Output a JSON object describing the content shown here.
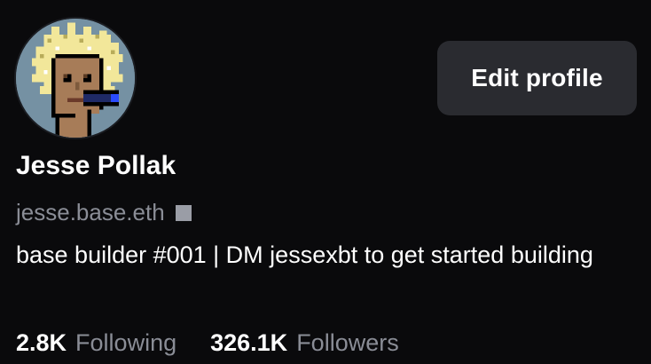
{
  "profile": {
    "display_name": "Jesse Pollak",
    "handle": "jesse.base.eth",
    "bio": "base builder #001 | DM jessexbt to get started building",
    "avatar_icon": "pixel-punk-avatar",
    "handle_badge_icon": "square-badge-icon"
  },
  "actions": {
    "edit_profile_label": "Edit profile"
  },
  "stats": {
    "following_count": "2.8K",
    "following_label": "Following",
    "followers_count": "326.1K",
    "followers_label": "Followers"
  },
  "colors": {
    "background": "#0a0a0c",
    "button_bg": "#2a2b30",
    "muted_text": "#8a8d96",
    "avatar_bg": "#7591a3"
  }
}
